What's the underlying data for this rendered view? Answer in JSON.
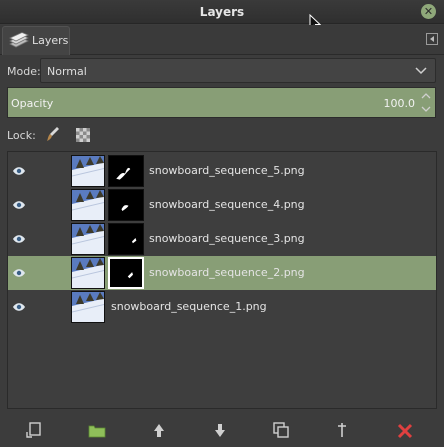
{
  "window": {
    "title": "Layers"
  },
  "tab": {
    "label": "Layers"
  },
  "mode": {
    "label": "Mode:",
    "value": "Normal"
  },
  "opacity": {
    "label": "Opacity",
    "value": "100.0",
    "level": 1.0,
    "fill_color": "#889e76"
  },
  "lock": {
    "label": "Lock:"
  },
  "layers": [
    {
      "name": "snowboard_sequence_5.png",
      "has_mask": true,
      "selected": false
    },
    {
      "name": "snowboard_sequence_4.png",
      "has_mask": true,
      "selected": false
    },
    {
      "name": "snowboard_sequence_3.png",
      "has_mask": true,
      "selected": false
    },
    {
      "name": "snowboard_sequence_2.png",
      "has_mask": true,
      "selected": true
    },
    {
      "name": "snowboard_sequence_1.png",
      "has_mask": false,
      "selected": false
    }
  ],
  "bottom_buttons": [
    {
      "icon": "new-layer-icon",
      "color": "#d0d0d0"
    },
    {
      "icon": "new-layer-group-icon",
      "color": "#8fbf5a"
    },
    {
      "icon": "raise-layer-icon",
      "color": "#d0d0d0"
    },
    {
      "icon": "lower-layer-icon",
      "color": "#d0d0d0"
    },
    {
      "icon": "duplicate-layer-icon",
      "color": "#d0d0d0"
    },
    {
      "icon": "anchor-layer-icon",
      "color": "#d0d0d0"
    },
    {
      "icon": "delete-layer-icon",
      "color": "#e04040"
    }
  ]
}
